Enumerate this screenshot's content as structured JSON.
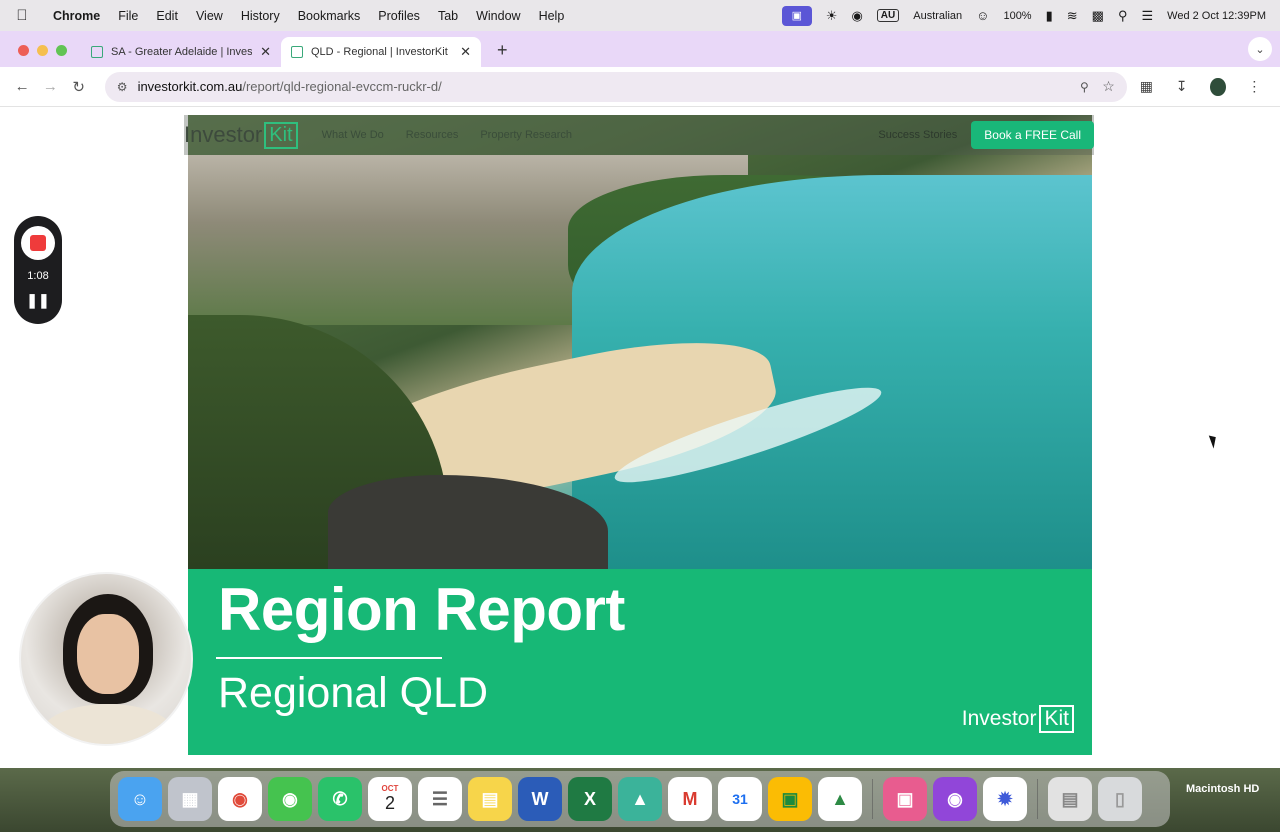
{
  "menubar": {
    "app_name": "Chrome",
    "items": [
      "File",
      "Edit",
      "View",
      "History",
      "Bookmarks",
      "Profiles",
      "Tab",
      "Window",
      "Help"
    ],
    "input_source": "Australian",
    "input_code": "AU",
    "battery": "100%",
    "datetime": "Wed 2 Oct  12:39PM"
  },
  "tabs": [
    {
      "title": "SA - Greater Adelaide | Invest"
    },
    {
      "title": "QLD - Regional | InvestorKit"
    }
  ],
  "address": {
    "host": "investorkit.com.au",
    "path": "/report/qld-regional-evccm-ruckr-d/"
  },
  "site_nav": {
    "logo_word": "Investor",
    "logo_box": "Kit",
    "links": [
      "What We Do",
      "Resources",
      "Property Research"
    ],
    "success": "Success Stories",
    "cta": "Book a FREE Call"
  },
  "band": {
    "title": "Region Report",
    "subtitle": "Regional QLD",
    "logo_word": "Investor",
    "logo_box": "Kit"
  },
  "recording": {
    "time": "1:08"
  },
  "dock": {
    "calendar_month": "OCT",
    "calendar_day": "2",
    "gcal_day": "31",
    "disk_label": "Macintosh HD"
  },
  "colors": {
    "brand_green": "#17b876",
    "tabbar": "#e9d8f8"
  }
}
